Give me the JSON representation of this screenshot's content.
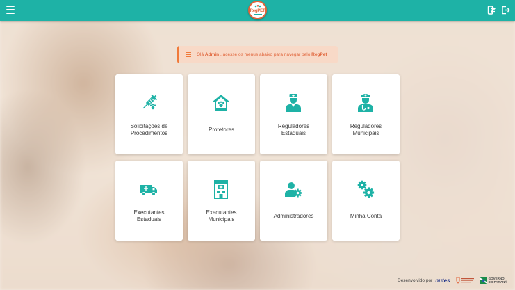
{
  "header": {
    "logo_text": "RegPET",
    "icons": {
      "menu": "hamburger-icon",
      "swap": "swap-profile-icon",
      "exit": "logout-icon"
    }
  },
  "alert": {
    "prefix": "Olá ",
    "user": "Admin",
    "middle": " , acesse os menus abaixo para navegar pelo ",
    "app": "RegPet",
    "suffix": " ."
  },
  "cards": [
    {
      "label_1": "Solicitações de",
      "label_2": "Procedimentos",
      "icon": "syringe-paw-icon"
    },
    {
      "label_1": "Protetores",
      "label_2": "",
      "icon": "pet-house-icon"
    },
    {
      "label_1": "Reguladores",
      "label_2": "Estaduais",
      "icon": "doctor-icon"
    },
    {
      "label_1": "Reguladores",
      "label_2": "Municipais",
      "icon": "doctor-stethoscope-icon"
    },
    {
      "label_1": "Executantes",
      "label_2": "Estaduais",
      "icon": "ambulance-icon"
    },
    {
      "label_1": "Executantes",
      "label_2": "Municipais",
      "icon": "clinic-building-icon"
    },
    {
      "label_1": "Administradores",
      "label_2": "",
      "icon": "user-gear-icon"
    },
    {
      "label_1": "Minha Conta",
      "label_2": "",
      "icon": "gears-icon"
    }
  ],
  "footer": {
    "developed_by": "Desenvolvido por",
    "nutes": "nutes",
    "gov_1": "GOVERNO",
    "gov_2": "DO PARANÁ"
  },
  "colors": {
    "primary": "#1eb2a6",
    "accent": "#e0643a",
    "alert_bg": "#f8d8c6"
  }
}
